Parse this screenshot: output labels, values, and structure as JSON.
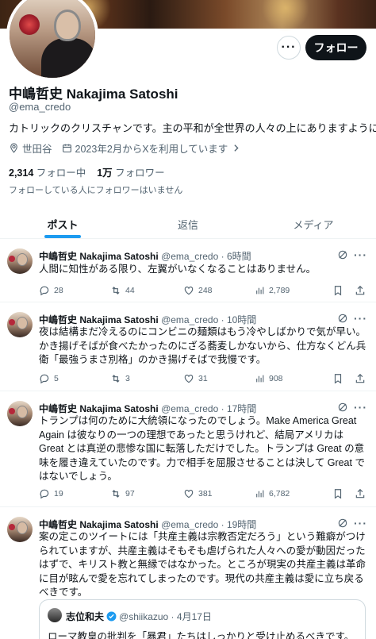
{
  "profile": {
    "name": "中嶋哲史 Nakajima Satoshi",
    "handle": "@ema_credo",
    "bio": "カトリックのクリスチャンです。主の平和が全世界の人々の上にありますように。",
    "location": "世田谷",
    "joined": "2023年2月からXを利用しています",
    "following_count": "2,314",
    "following_label": "フォロー中",
    "followers_count": "1万",
    "followers_label": "フォロワー",
    "no_mutuals": "フォローしている人にフォロワーはいません",
    "follow_button": "フォロー",
    "more_button": "···"
  },
  "tabs": [
    {
      "label": "ポスト",
      "active": true
    },
    {
      "label": "返信",
      "active": false
    },
    {
      "label": "メディア",
      "active": false
    }
  ],
  "tweets": [
    {
      "name": "中嶋哲史 Nakajima Satoshi",
      "meta": "@ema_credo · 6時間",
      "text": "人間に知性がある限り、左翼がいなくなることはありません。",
      "replies": "28",
      "retweets": "44",
      "likes": "248",
      "views": "2,789"
    },
    {
      "name": "中嶋哲史 Nakajima Satoshi",
      "meta": "@ema_credo · 10時間",
      "text": "夜は結構まだ冷えるのにコンビニの麺類はもう冷やしばかりで気が早い。かき揚げそばが食べたかったのにざる蕎麦しかないから、仕方なくどん兵衛「最強うまさ別格」のかき揚げそばで我慢です。",
      "replies": "5",
      "retweets": "3",
      "likes": "31",
      "views": "908"
    },
    {
      "name": "中嶋哲史 Nakajima Satoshi",
      "meta": "@ema_credo · 17時間",
      "text": "トランプは何のために大統領になったのでしょう。Make America Great Again は彼なりの一つの理想であったと思うけれど、結局アメリカは Great とは真逆の悲惨な国に転落しただけでした。トランプは Great の意味を履き違えていたのです。力で相手を屈服させることは決して Great ではないでしょう。",
      "replies": "19",
      "retweets": "97",
      "likes": "381",
      "views": "6,782"
    },
    {
      "name": "中嶋哲史 Nakajima Satoshi",
      "meta": "@ema_credo · 19時間",
      "text": "案の定このツイートには「共産主義は宗教否定だろう」という難癖がつけられていますが、共産主義はそもそも虐げられた人々への愛が動因だったはずで、キリスト教と無縁ではなかった。ところが現実の共産主義は革命に目が眩んで愛を忘れてしまったのです。現代の共産主義は愛に立ち戻るべきです。",
      "quote": {
        "name": "志位和夫",
        "meta": "@shiikazuo · 4月17日",
        "text": "ローマ教皇の批判を「暴君」たちはしっかりと受け止めるべきです。"
      }
    }
  ],
  "colors": {
    "accent": "#1d9bf0",
    "text": "#0f1419",
    "muted": "#536471",
    "border": "#eff3f4"
  }
}
